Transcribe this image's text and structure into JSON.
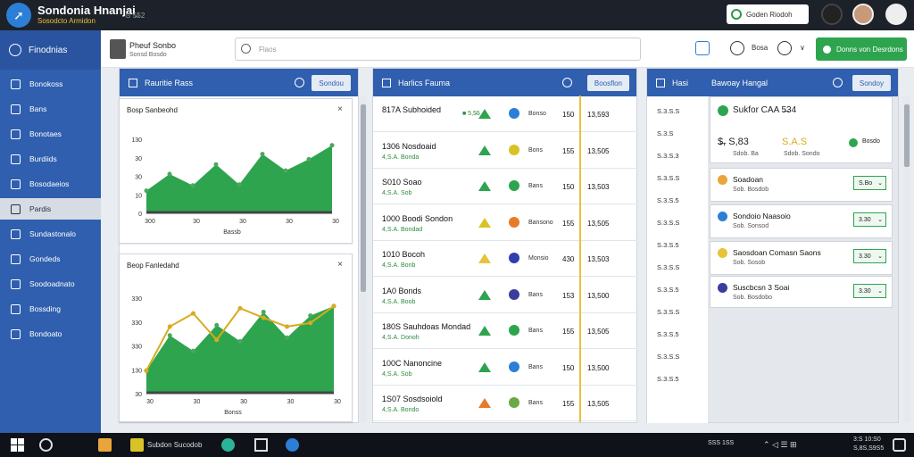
{
  "app": {
    "title": "Sondonia Hnanjai",
    "subtitle": "Sosodcto Armidon",
    "extra": "⊙ 5̶52"
  },
  "topbar": {
    "button_label": "Goden Riodoh"
  },
  "sidebar": {
    "header": "Finodnias",
    "items": [
      {
        "label": "Bonokoss"
      },
      {
        "label": "Bans"
      },
      {
        "label": "Bonotaes"
      },
      {
        "label": "Burdiids"
      },
      {
        "label": "Bosodaeios"
      },
      {
        "label": "Pardis",
        "active": true
      },
      {
        "label": "Sundastonalo"
      },
      {
        "label": "Gondeds"
      },
      {
        "label": "Soodoadnato"
      },
      {
        "label": "Bossding"
      },
      {
        "label": "Bondoato"
      }
    ]
  },
  "toolbar": {
    "user_name": "Pheuf Sonbo",
    "user_sub": "Sonsd Bosdo",
    "search_placeholder": "Flaos",
    "item_label": "Bosa",
    "green_button": "Donns von Desrdons"
  },
  "panel1": {
    "title": "Rauritie Rass",
    "button": "Sondou",
    "chart1": {
      "title": "Bosp  Sanbeohd"
    },
    "chart2": {
      "title": "Beop  Fanledahd"
    }
  },
  "panel2": {
    "title": "Harlics Fauma",
    "button": "Boosflon",
    "rows": [
      {
        "name": "817A  Subhoided",
        "sub": "",
        "change": "■ 5,5̶5",
        "tag": "Bonso",
        "num": "150",
        "val": "13,593",
        "icon_color": "#2b7fd6",
        "tri_color": "#2ea44f"
      },
      {
        "name": "1306  Nosdoaid",
        "sub": "4,S.A. Bonda",
        "change": "",
        "tag": "Bons",
        "num": "155",
        "val": "13,505",
        "icon_color": "#d8c326",
        "tri_color": "#2ea44f"
      },
      {
        "name": "S010  Soao",
        "sub": "4,S.A. Sob",
        "change": "",
        "tag": "Bans",
        "num": "150",
        "val": "13,503",
        "icon_color": "#2ea44f",
        "tri_color": "#2ea44f"
      },
      {
        "name": "1000  Boodi Sondon",
        "sub": "4,S.A. Bondad",
        "change": "",
        "tag": "Bansono",
        "num": "155",
        "val": "13,505",
        "icon_color": "#e77b2a",
        "tri_color": "#d8c326"
      },
      {
        "name": "1010  Bocoh",
        "sub": "4,S.A. Bonb",
        "change": "",
        "tag": "Monsio",
        "num": "430",
        "val": "13,503",
        "icon_color": "#2f3fae",
        "tri_color": "#e8c33a"
      },
      {
        "name": "1A0  Bonds",
        "sub": "4,S.A. Boob",
        "change": "",
        "tag": "Bans",
        "num": "153",
        "val": "13,500",
        "icon_color": "#3a3c9e",
        "tri_color": "#2ea44f"
      },
      {
        "name": "180S  Sauhdoas Mondad",
        "sub": "4,S.A. Donoh",
        "change": "",
        "tag": "Bans",
        "num": "155",
        "val": "13,505",
        "icon_color": "#2ea44f",
        "tri_color": "#2ea44f"
      },
      {
        "name": "100C  Nanoncine",
        "sub": "4,S.A. Sob",
        "change": "",
        "tag": "Bans",
        "num": "150",
        "val": "13,500",
        "icon_color": "#2b7fd6",
        "tri_color": "#2ea44f"
      },
      {
        "name": "1S07  Sosdsoiold",
        "sub": "4,S.A. Bondo",
        "change": "",
        "tag": "Bans",
        "num": "155",
        "val": "13,505",
        "icon_color": "#6aaa44",
        "tri_color": "#e77b2a"
      }
    ]
  },
  "panel3": {
    "title": "Hasi",
    "title2": "Bawoay Hangal",
    "button": "Sondoy",
    "list": [
      "S.3.S.S",
      "S.3.S",
      "S.3.S.3",
      "S.3.S.S",
      "S.3.S.5",
      "S.3.S.S",
      "S.3.S.5",
      "S.3.S.S",
      "S.3.S.5",
      "S.3.S.S",
      "S.3.S.5",
      "S.3.S.S",
      "S.3.S.5"
    ],
    "big": {
      "title": "Sukfor CAA 5̶34",
      "v1": "$̶, S,83",
      "v2": "S.A.S",
      "sub1": "Sdob. Ba",
      "sub2": "Sdob. Sondo",
      "badge": "Bosdo"
    },
    "cards": [
      {
        "t1": "Soadoan",
        "t2": "Sob. Bosdob",
        "sel": "S.Bo",
        "color": "#e8a53a"
      },
      {
        "t1": "Sondoio Naasoio",
        "t2": "Sob. Sonsod",
        "sel": "3.30",
        "color": "#2b7fd6"
      },
      {
        "t1": "Saosdoan Comasn Saons",
        "t2": "Sob. Sosob",
        "sel": "3.30",
        "color": "#e8c33a"
      },
      {
        "t1": "Suscbcsn 3 Soai",
        "t2": "Sob. Bosdobo",
        "sel": "3.30",
        "color": "#3a3c9e"
      }
    ]
  },
  "taskbar": {
    "item_label": "Subdon Sucodob",
    "clock": "3:S 10:S0",
    "date": "S,8S,S9S5",
    "tray_label": "SSS 1SS"
  },
  "chart_data": [
    {
      "type": "area",
      "title": "Bosp  Sanbeohd",
      "xlabel": "Bassb",
      "x": [
        "300",
        "30",
        "30",
        "30",
        "30"
      ],
      "yticks": [
        "130",
        "30",
        "30",
        "10",
        "0"
      ],
      "series": [
        {
          "values": [
            25,
            44,
            31,
            55,
            32,
            67,
            48,
            61,
            77
          ],
          "color": "#2ea44f"
        }
      ]
    },
    {
      "type": "area",
      "title": "Beop  Fanledahd",
      "xlabel": "Bonss",
      "x": [
        "30",
        "30",
        "30",
        "30",
        "30"
      ],
      "yticks": [
        "330",
        "330",
        "330",
        "130",
        "30"
      ],
      "series": [
        {
          "values": [
            30,
            78,
            57,
            92,
            70,
            110,
            75,
            105,
            118
          ],
          "color": "#2ea44f"
        },
        {
          "values": [
            30,
            90,
            108,
            72,
            115,
            102,
            90,
            95,
            118
          ],
          "color": "#d8ac1c"
        }
      ]
    }
  ]
}
